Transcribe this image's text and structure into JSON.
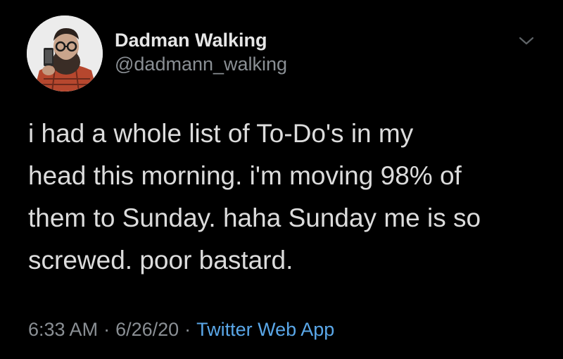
{
  "author": {
    "display_name": "Dadman Walking",
    "handle": "@dadmann_walking",
    "avatar_icon": "profile-photo"
  },
  "menu": {
    "icon": "chevron-down-icon"
  },
  "tweet": {
    "text": "i had a whole list of To-Do's in my\nhead this morning. i'm moving 98% of\nthem to Sunday. haha Sunday me is so\nscrewed. poor bastard."
  },
  "meta": {
    "time": "6:33 AM",
    "separator": "·",
    "date": "6/26/20",
    "source": "Twitter Web App"
  },
  "colors": {
    "background": "#000000",
    "text": "#dcdcdc",
    "muted": "#8a8f94",
    "link": "#5aa7e8"
  }
}
